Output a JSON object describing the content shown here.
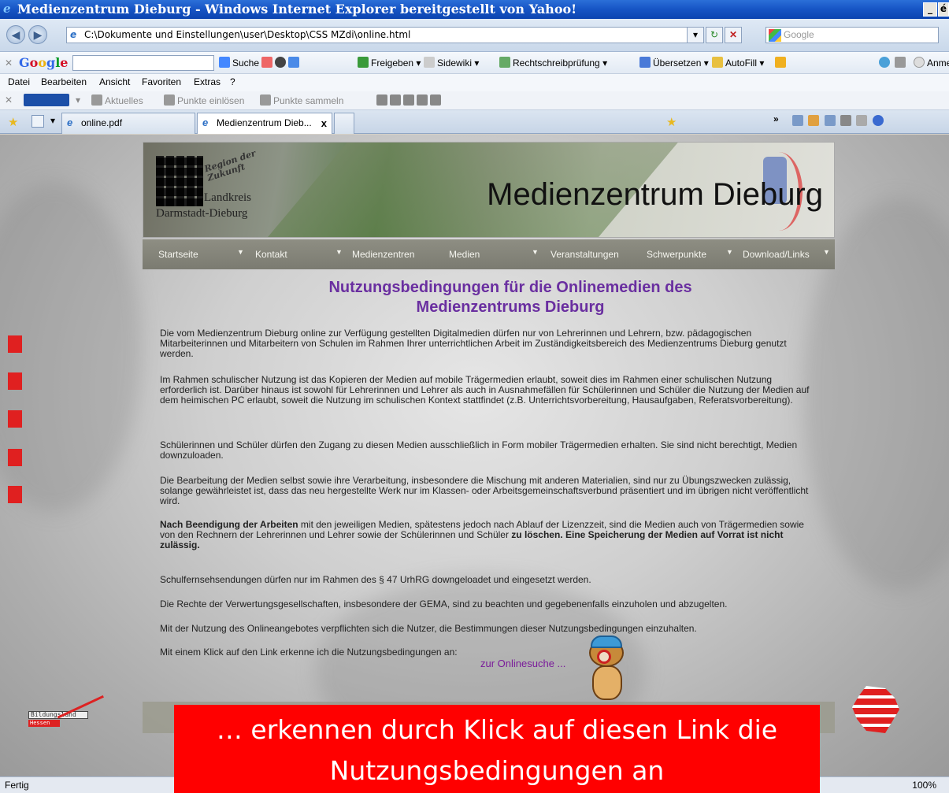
{
  "window": {
    "title": "Medienzentrum Dieburg - Windows Internet Explorer bereitgestellt von Yahoo!",
    "controls": [
      "_",
      "é"
    ]
  },
  "address": {
    "url": "C:\\Dokumente und Einstellungen\\user\\Desktop\\CSS MZdi\\online.html",
    "search_placeholder": "Google"
  },
  "google_toolbar": {
    "logo": "Google",
    "items": [
      "Suche ▾",
      "Freigeben ▾",
      "Sidewiki ▾",
      "Rechtschreibprüfung ▾",
      "Übersetzen ▾",
      "AutoFill ▾",
      "Anmeld"
    ]
  },
  "menu": {
    "items": [
      "Datei",
      "Bearbeiten",
      "Ansicht",
      "Favoriten",
      "Extras",
      "?"
    ]
  },
  "payback_toolbar": {
    "items": [
      "Aktuelles",
      "Punkte einlösen",
      "Punkte sammeln"
    ]
  },
  "tabs": [
    {
      "label": "online.pdf"
    },
    {
      "label": "Medienzentrum Dieb...",
      "close": "x"
    }
  ],
  "banner": {
    "region": "Region der Zukunft",
    "landkreis": "Landkreis",
    "darmstadt": "Darmstadt-Dieburg",
    "title": "Medienzentrum Dieburg"
  },
  "nav": {
    "items": [
      "Startseite",
      "Kontakt",
      "Medienzentren",
      "Medien",
      "Veranstaltungen",
      "Schwerpunkte",
      "Download/Links"
    ]
  },
  "content": {
    "headline": "Nutzungsbedingungen für die Onlinemedien des Medienzentrums Dieburg",
    "p1": "Die vom Medienzentrum Dieburg online zur Verfügung gestellten Digitalmedien dürfen nur von Lehrerinnen und Lehrern, bzw. pädagogischen Mitarbeiterinnen und Mitarbeitern von Schulen im Rahmen Ihrer unterrichtlichen Arbeit im Zuständigkeitsbereich des Medienzentrums Dieburg genutzt werden.",
    "p2": "Im Rahmen schulischer Nutzung ist das Kopieren der Medien auf mobile Trägermedien erlaubt, soweit dies im Rahmen einer schulischen Nutzung erforderlich ist. Darüber hinaus ist sowohl für Lehrerinnen und Lehrer als auch in Ausnahmefällen für Schülerinnen und Schüler die Nutzung der Medien auf dem heimischen PC erlaubt, soweit die Nutzung im schulischen Kontext stattfindet (z.B. Unterrichtsvorbereitung, Hausaufgaben, Referatsvorbereitung).",
    "p3": "Schülerinnen und Schüler dürfen den Zugang zu diesen Medien ausschließlich in Form mobiler Trägermedien erhalten. Sie sind nicht berechtigt, Medien downzuloaden.",
    "p4": "Die Bearbeitung der Medien selbst sowie ihre Verarbeitung, insbesondere die Mischung mit anderen Materialien, sind nur zu Übungszwecken zulässig, solange gewährleistet ist, dass das neu hergestellte Werk nur im Klassen- oder Arbeitsgemeinschaftsverbund präsentiert und im übrigen nicht veröffentlicht wird.",
    "p5_bold1": "Nach Beendigung der Arbeiten",
    "p5_text": " mit den jeweiligen Medien, spätestens jedoch nach Ablauf der Lizenzzeit, sind die Medien auch von Trägermedien sowie von den Rechnern der Lehrerinnen und Lehrer sowie der Schülerinnen und Schüler ",
    "p5_bold2": "zu löschen. Eine Speicherung der Medien auf Vorrat ist nicht zulässig.",
    "p6": "Schulfernsehsendungen dürfen nur im Rahmen des § 47 UrhRG downgeloadet und eingesetzt werden.",
    "p7": "Die Rechte der Verwertungsgesellschaften, insbesondere der GEMA, sind zu beachten und gegebenenfalls einzuholen und abzugelten.",
    "p8": "Mit der Nutzung des Onlineangebotes verpflichten sich die Nutzer, die Bestimmungen dieser Nutzungsbedingungen einzuhalten.",
    "p9": "Mit einem Klick auf den Link erkenne ich die Nutzungsbedingungen an:",
    "link": "zur Onlinesuche ..."
  },
  "footer": {
    "bildungsland_1": "Bildungsland",
    "bildungsland_2": "Hessen"
  },
  "status": {
    "text": "Fertig",
    "zoom": "100%"
  },
  "annotation": {
    "line1": "… erkennen durch Klick auf diesen Link die",
    "line2": "Nutzungsbedingungen an"
  },
  "colors": {
    "headline": "#6a2fa0",
    "annotation_bg": "#ff0000",
    "nav_bg": "#8e8e83"
  }
}
